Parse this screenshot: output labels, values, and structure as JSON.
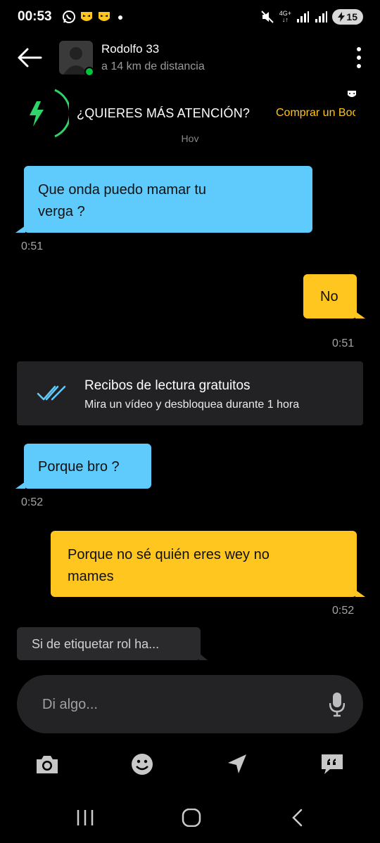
{
  "status_bar": {
    "time": "00:53",
    "network": "4G+",
    "battery": "15"
  },
  "header": {
    "name": "Rodolfo 33",
    "distance": "a 14 km de distancia"
  },
  "promo": {
    "text": "¿QUIERES MÁS ATENCIÓN?",
    "link": "Comprar un Boost",
    "day_label": "Hoy"
  },
  "messages": [
    {
      "direction": "in",
      "lines": [
        "Que onda puedo mamar tu",
        "verga ?"
      ],
      "time": "0:51"
    },
    {
      "direction": "out",
      "lines": [
        "No"
      ],
      "time": "0:51"
    },
    {
      "direction": "in",
      "lines": [
        "Porque bro ?"
      ],
      "time": "0:52"
    },
    {
      "direction": "out",
      "lines": [
        "Porque no sé quién eres wey no",
        "mames"
      ],
      "time": "0:52"
    }
  ],
  "receipts_card": {
    "title": "Recibos de lectura gratuitos",
    "subtitle": "Mira un vídeo y desbloquea durante 1 hora"
  },
  "suggestion": {
    "text": "Si de etiquetar rol ha..."
  },
  "composer": {
    "placeholder": "Di algo..."
  },
  "colors": {
    "incoming_bubble": "#5fcbfc",
    "outgoing_bubble": "#ffc61f",
    "accent_link": "#ffc41a",
    "online": "#00c53a",
    "boost_green": "#2fd36a"
  },
  "icons": {
    "actions": [
      "camera-icon",
      "emoji-icon",
      "location-arrow-icon",
      "quick-phrases-icon"
    ],
    "nav": [
      "recents-icon",
      "home-icon",
      "back-nav-icon"
    ]
  }
}
